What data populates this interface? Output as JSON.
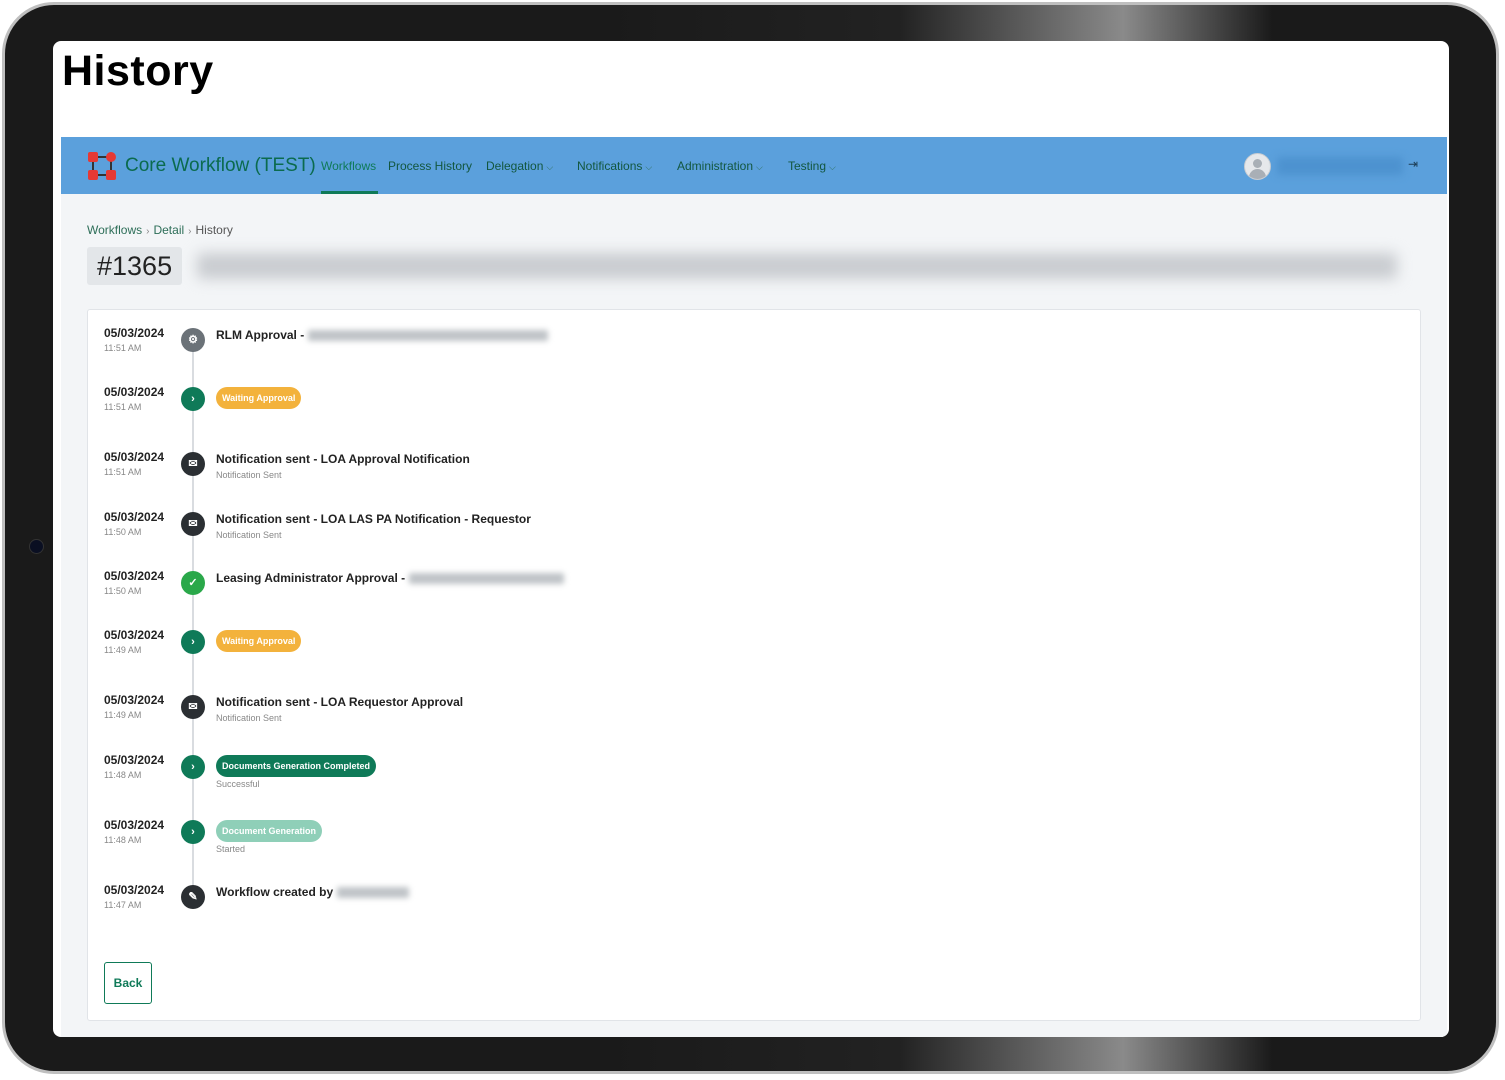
{
  "slide_title": "History",
  "navbar": {
    "brand": "Core Workflow (TEST)",
    "links": [
      {
        "label": "Workflows",
        "dropdown": false,
        "active": true
      },
      {
        "label": "Process History",
        "dropdown": false,
        "active": false
      },
      {
        "label": "Delegation",
        "dropdown": true,
        "active": false
      },
      {
        "label": "Notifications",
        "dropdown": true,
        "active": false
      },
      {
        "label": "Administration",
        "dropdown": true,
        "active": false
      },
      {
        "label": "Testing",
        "dropdown": true,
        "active": false
      }
    ],
    "chevron": "⌵",
    "logout_icon": "⇥"
  },
  "breadcrumb": {
    "items": [
      "Workflows",
      "Detail",
      "History"
    ],
    "separator": "›"
  },
  "workflow": {
    "id": "#1365"
  },
  "timeline": [
    {
      "date": "05/03/2024",
      "time": "11:51 AM",
      "icon": "gear-icon",
      "icon_glyph": "⚙",
      "text": "RLM Approval -",
      "blurred": true
    },
    {
      "date": "05/03/2024",
      "time": "11:51 AM",
      "icon": "arrow-icon",
      "icon_glyph": "›",
      "badge": "Waiting Approval",
      "badge_style": "orange"
    },
    {
      "date": "05/03/2024",
      "time": "11:51 AM",
      "icon": "mail-icon",
      "icon_glyph": "✉",
      "text": "Notification sent - LOA Approval Notification",
      "sub": "Notification Sent"
    },
    {
      "date": "05/03/2024",
      "time": "11:50 AM",
      "icon": "mail-icon",
      "icon_glyph": "✉",
      "text": "Notification sent - LOA LAS PA Notification - Requestor",
      "sub": "Notification Sent"
    },
    {
      "date": "05/03/2024",
      "time": "11:50 AM",
      "icon": "check-icon",
      "icon_glyph": "✓",
      "text": "Leasing Administrator Approval -",
      "blurred": true
    },
    {
      "date": "05/03/2024",
      "time": "11:49 AM",
      "icon": "arrow-icon",
      "icon_glyph": "›",
      "badge": "Waiting Approval",
      "badge_style": "orange"
    },
    {
      "date": "05/03/2024",
      "time": "11:49 AM",
      "icon": "mail-icon",
      "icon_glyph": "✉",
      "text": "Notification sent - LOA Requestor Approval",
      "sub": "Notification Sent"
    },
    {
      "date": "05/03/2024",
      "time": "11:48 AM",
      "icon": "arrow-icon",
      "icon_glyph": "›",
      "badge": "Documents Generation Completed",
      "badge_style": "green",
      "sub": "Successful"
    },
    {
      "date": "05/03/2024",
      "time": "11:48 AM",
      "icon": "arrow-icon",
      "icon_glyph": "›",
      "badge": "Document Generation",
      "badge_style": "mint",
      "sub": "Started"
    },
    {
      "date": "05/03/2024",
      "time": "11:47 AM",
      "icon": "pencil-icon",
      "icon_glyph": "✎",
      "text": "Workflow created by",
      "blurred": true
    }
  ],
  "back_button": "Back",
  "colors": {
    "navbar": "#5ba0dc",
    "accent": "#0f7a58",
    "waiting": "#f3b23c",
    "started": "#8fcfb8"
  }
}
